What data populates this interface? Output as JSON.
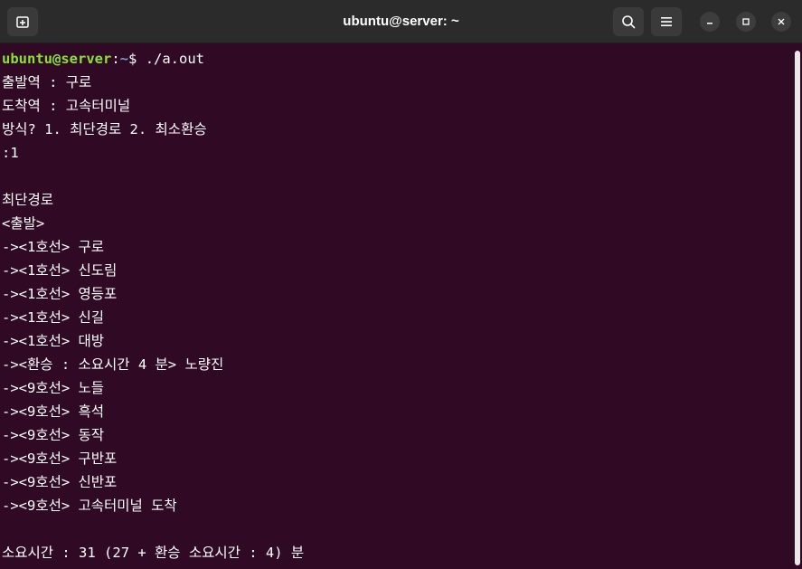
{
  "window": {
    "title": "ubuntu@server: ~"
  },
  "prompt": {
    "user_host": "ubuntu@server",
    "sep": ":",
    "path": "~",
    "symbol": "$ ",
    "command": "./a.out"
  },
  "lines": [
    "출발역 : 구로",
    "도착역 : 고속터미널",
    "방식? 1. 최단경로 2. 최소환승",
    ":1",
    "",
    "최단경로",
    "<출발>",
    "-><1호선> 구로",
    "-><1호선> 신도림",
    "-><1호선> 영등포",
    "-><1호선> 신길",
    "-><1호선> 대방",
    "-><환승 : 소요시간 4 분> 노량진",
    "-><9호선> 노들",
    "-><9호선> 흑석",
    "-><9호선> 동작",
    "-><9호선> 구반포",
    "-><9호선> 신반포",
    "-><9호선> 고속터미널 도착",
    "",
    "소요시간 : 31 (27 + 환승 소요시간 : 4) 분"
  ],
  "icons": {
    "new_tab": "new-tab-icon",
    "search": "search-icon",
    "menu": "hamburger-menu-icon",
    "minimize": "minimize-icon",
    "maximize": "maximize-icon",
    "close": "close-icon"
  },
  "colors": {
    "terminal_bg": "#300a24",
    "titlebar_bg": "#2b2b2b",
    "prompt_user": "#8ae234",
    "prompt_path": "#729fcf",
    "text": "#ffffff"
  }
}
